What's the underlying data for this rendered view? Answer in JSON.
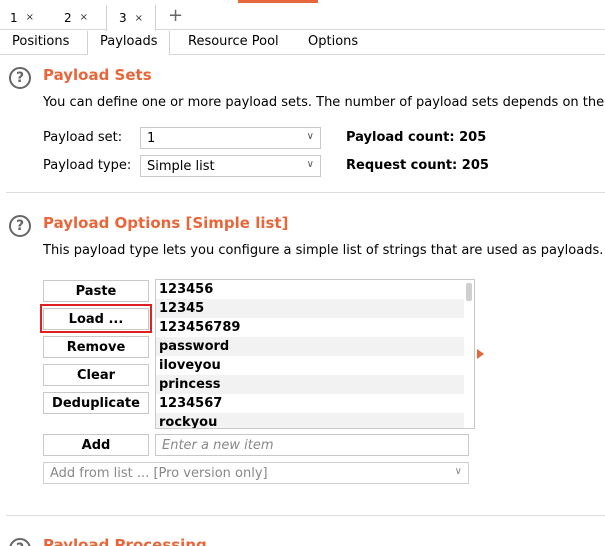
{
  "request_tabs": [
    {
      "label": "1",
      "close": "×"
    },
    {
      "label": "2",
      "close": "×"
    },
    {
      "label": "3",
      "close": "×"
    }
  ],
  "add_tab": "+",
  "sub_tabs": [
    "Positions",
    "Payloads",
    "Resource Pool",
    "Options"
  ],
  "payload_sets": {
    "title": "Payload Sets",
    "description": "You can define one or more payload sets. The number of payload sets depends on the atta",
    "payload_set_label": "Payload set:",
    "payload_set_value": "1",
    "payload_type_label": "Payload type:",
    "payload_type_value": "Simple list",
    "payload_count": "Payload count: 205",
    "request_count": "Request count: 205"
  },
  "payload_options": {
    "title": "Payload Options [Simple list]",
    "description": "This payload type lets you configure a simple list of strings that are used as payloads.",
    "buttons": {
      "paste": "Paste",
      "load": "Load ...",
      "remove": "Remove",
      "clear": "Clear",
      "deduplicate": "Deduplicate",
      "add": "Add"
    },
    "items": [
      "123456",
      "12345",
      "123456789",
      "password",
      "iloveyou",
      "princess",
      "1234567",
      "rockyou"
    ],
    "new_item_placeholder": "Enter a new item",
    "add_from_list": "Add from list ... [Pro version only]"
  },
  "payload_processing": {
    "title": "Payload Processing"
  },
  "help_glyph": "?",
  "chevron_glyph": "∨",
  "colors": {
    "accent": "#e8673a",
    "highlight": "#e02020"
  }
}
